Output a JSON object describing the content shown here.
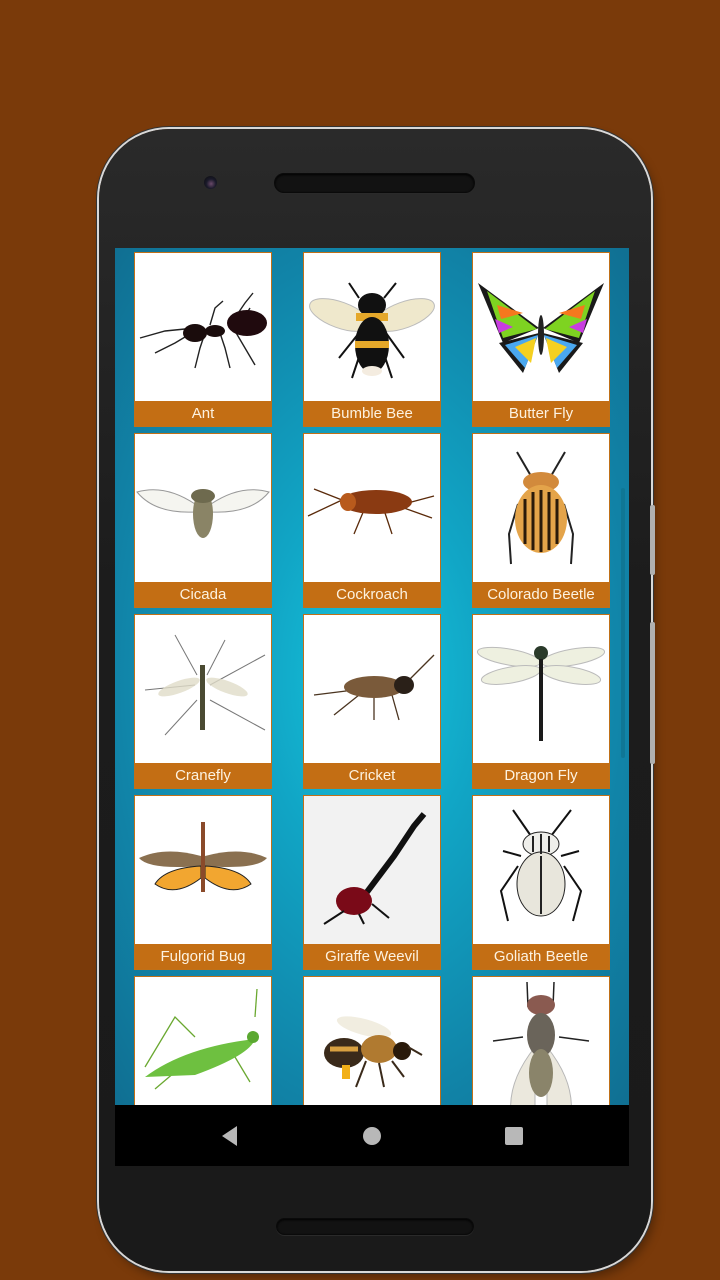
{
  "app": {
    "screen": "insect-grid"
  },
  "colors": {
    "page_background": "#7a3a0a",
    "label_background": "#c36e14",
    "label_text": "#fdf2e0",
    "tile_border": "#c07018",
    "grid_background": "#11a6c6"
  },
  "grid": {
    "items": [
      {
        "label": "Ant",
        "icon": "ant-image"
      },
      {
        "label": "Bumble Bee",
        "icon": "bumble-bee-image"
      },
      {
        "label": "Butter Fly",
        "icon": "butterfly-image"
      },
      {
        "label": "Cicada",
        "icon": "cicada-image"
      },
      {
        "label": "Cockroach",
        "icon": "cockroach-image"
      },
      {
        "label": "Colorado Beetle",
        "icon": "colorado-beetle-image"
      },
      {
        "label": "Cranefly",
        "icon": "cranefly-image"
      },
      {
        "label": "Cricket",
        "icon": "cricket-image"
      },
      {
        "label": "Dragon Fly",
        "icon": "dragonfly-image"
      },
      {
        "label": "Fulgorid Bug",
        "icon": "fulgorid-bug-image"
      },
      {
        "label": "Giraffe Weevil",
        "icon": "giraffe-weevil-image"
      },
      {
        "label": "Goliath Beetle",
        "icon": "goliath-beetle-image"
      },
      {
        "label": "",
        "icon": "katydid-image"
      },
      {
        "label": "",
        "icon": "honey-bee-image"
      },
      {
        "label": "",
        "icon": "housefly-image"
      }
    ]
  },
  "navbar": {
    "back": "back-icon",
    "home": "home-icon",
    "recents": "recents-icon"
  }
}
